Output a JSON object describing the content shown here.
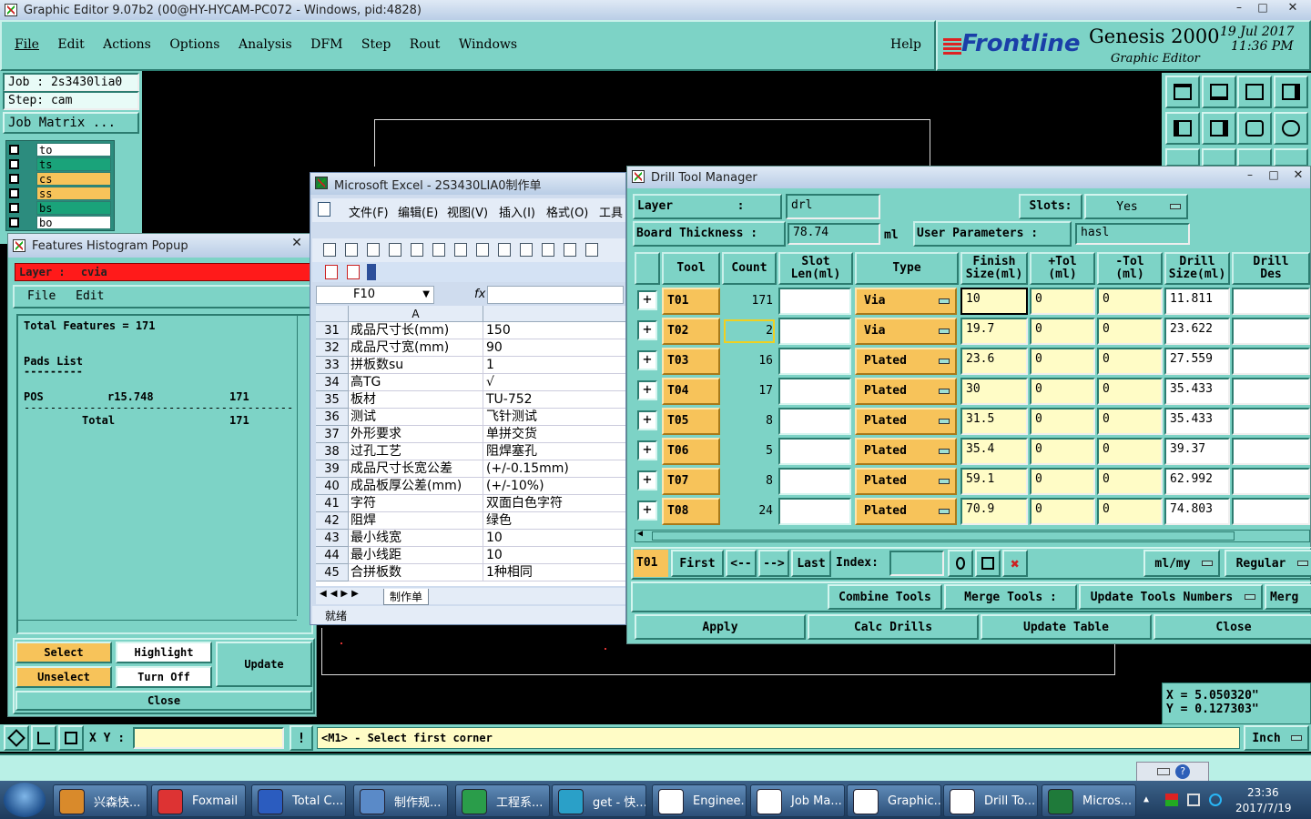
{
  "window_title": "Graphic Editor 9.07b2 (00@HY-HYCAM-PC072 - Windows, pid:4828)",
  "menu": [
    "File",
    "Edit",
    "Actions",
    "Options",
    "Analysis",
    "DFM",
    "Step",
    "Rout",
    "Windows"
  ],
  "help": "Help",
  "brand": {
    "logo": "Frontline",
    "product": "Genesis 2000",
    "subtitle": "Graphic Editor",
    "date": "19 Jul 2017",
    "time": "11:36 PM"
  },
  "job": {
    "job": "Job : 2s3430lia0",
    "step": "Step: cam",
    "matrix": "Job Matrix ..."
  },
  "layers": [
    {
      "name": "to",
      "color": "#ffffff"
    },
    {
      "name": "ts",
      "color": "#1aa37a"
    },
    {
      "name": "cs",
      "color": "#f7c35a"
    },
    {
      "name": "ss",
      "color": "#f7c35a"
    },
    {
      "name": "bs",
      "color": "#1aa37a"
    },
    {
      "name": "bo",
      "color": "#ffffff"
    }
  ],
  "histogram": {
    "title": "Features Histogram Popup",
    "layer_label": "Layer :",
    "layer": "cvia",
    "menu": [
      "File",
      "Edit"
    ],
    "total": "Total Features = 171",
    "pads_list": "Pads List",
    "underline": "---------",
    "pos": "POS",
    "symbol": "r15.748",
    "count": "171",
    "divider": "-----------------------------------------",
    "total_label": "Total",
    "total_count": "171",
    "buttons": {
      "select": "Select",
      "highlight": "Highlight",
      "update": "Update",
      "unselect": "Unselect",
      "turn_off": "Turn Off",
      "close": "Close"
    }
  },
  "excel": {
    "title": "Microsoft Excel - 2S3430LIA0制作单",
    "menu": [
      "文件(F)",
      "编辑(E)",
      "视图(V)",
      "插入(I)",
      "格式(O)",
      "工具"
    ],
    "cell_ref": "F10",
    "fx": "fx",
    "col_a": "A",
    "rows": [
      {
        "n": "31",
        "a": "成品尺寸长(mm)",
        "b": "150"
      },
      {
        "n": "32",
        "a": "成品尺寸宽(mm)",
        "b": "90"
      },
      {
        "n": "33",
        "a": "拼板数su",
        "b": "1"
      },
      {
        "n": "34",
        "a": "高TG",
        "b": "√"
      },
      {
        "n": "35",
        "a": "板材",
        "b": "TU-752"
      },
      {
        "n": "36",
        "a": "测试",
        "b": "飞针测试"
      },
      {
        "n": "37",
        "a": "外形要求",
        "b": "单拼交货"
      },
      {
        "n": "38",
        "a": "过孔工艺",
        "b": "阻焊塞孔"
      },
      {
        "n": "39",
        "a": "成品尺寸长宽公差",
        "b": "(+/-0.15mm)"
      },
      {
        "n": "40",
        "a": "成品板厚公差(mm)",
        "b": "(+/-10%)"
      },
      {
        "n": "41",
        "a": "字符",
        "b": "双面白色字符"
      },
      {
        "n": "42",
        "a": "阻焊",
        "b": "绿色"
      },
      {
        "n": "43",
        "a": "最小线宽",
        "b": "10"
      },
      {
        "n": "44",
        "a": "最小线距",
        "b": "10"
      },
      {
        "n": "45",
        "a": "合拼板数",
        "b": "1种相同"
      }
    ],
    "sheet_tab": "制作单",
    "status": "就绪"
  },
  "drill": {
    "title": "Drill Tool Manager",
    "layer_label": "Layer         :",
    "layer": "drl",
    "slots_label": "Slots:",
    "slots": "Yes",
    "thickness_label": "Board Thickness :",
    "thickness": "78.74",
    "thickness_unit": "ml",
    "user_params_label": "User Parameters :",
    "user_params": "hasl",
    "headers": [
      "Tool",
      "Count",
      "Slot\nLen(ml)",
      "Type",
      "Finish\nSize(ml)",
      "+Tol\n(ml)",
      "-Tol\n(ml)",
      "Drill\nSize(ml)",
      "Drill\nDes"
    ],
    "rows": [
      {
        "tool": "T01",
        "count": "171",
        "type": "Via",
        "finish": "10",
        "ptol": "0",
        "ntol": "0",
        "drill": "11.811"
      },
      {
        "tool": "T02",
        "count": "2",
        "type": "Via",
        "finish": "19.7",
        "ptol": "0",
        "ntol": "0",
        "drill": "23.622"
      },
      {
        "tool": "T03",
        "count": "16",
        "type": "Plated",
        "finish": "23.6",
        "ptol": "0",
        "ntol": "0",
        "drill": "27.559"
      },
      {
        "tool": "T04",
        "count": "17",
        "type": "Plated",
        "finish": "30",
        "ptol": "0",
        "ntol": "0",
        "drill": "35.433"
      },
      {
        "tool": "T05",
        "count": "8",
        "type": "Plated",
        "finish": "31.5",
        "ptol": "0",
        "ntol": "0",
        "drill": "35.433"
      },
      {
        "tool": "T06",
        "count": "5",
        "type": "Plated",
        "finish": "35.4",
        "ptol": "0",
        "ntol": "0",
        "drill": "39.37"
      },
      {
        "tool": "T07",
        "count": "8",
        "type": "Plated",
        "finish": "59.1",
        "ptol": "0",
        "ntol": "0",
        "drill": "62.992"
      },
      {
        "tool": "T08",
        "count": "24",
        "type": "Plated",
        "finish": "70.9",
        "ptol": "0",
        "ntol": "0",
        "drill": "74.803"
      }
    ],
    "current_tool": "T01",
    "nav": {
      "first": "First",
      "prev": "<--",
      "next": "-->",
      "last": "Last",
      "index": "Index:"
    },
    "units": "ml/my",
    "mode": "Regular",
    "combine": "Combine Tools",
    "merge": "Merge Tools :",
    "update_numbers": "Update Tools Numbers",
    "merge2": "Merg",
    "apply": "Apply",
    "calc": "Calc Drills",
    "update_table": "Update Table",
    "close": "Close"
  },
  "coords": {
    "x": "X = 5.050320\"",
    "y": "Y = 0.127303\""
  },
  "status_bar": {
    "xy_label": "X Y :",
    "prompt": "<M1> - Select first corner",
    "units": "Inch"
  },
  "taskbar": {
    "apps": [
      {
        "label": "兴森快...",
        "color": "#d98a2b"
      },
      {
        "label": "Foxmail",
        "color": "#d33"
      },
      {
        "label": "Total C...",
        "color": "#2b5cbf"
      },
      {
        "label": "制作规...",
        "color": "#5a8ac8"
      },
      {
        "label": "工程系...",
        "color": "#2a9d4a"
      },
      {
        "label": "get - 快...",
        "color": "#2aa0c8"
      },
      {
        "label": "Enginee...",
        "color": "#ffffff"
      },
      {
        "label": "Job Ma...",
        "color": "#ffffff"
      },
      {
        "label": "Graphic...",
        "color": "#ffffff"
      },
      {
        "label": "Drill To...",
        "color": "#ffffff"
      },
      {
        "label": "Micros...",
        "color": "#1f7a3a"
      }
    ],
    "time": "23:36",
    "date": "2017/7/19"
  }
}
